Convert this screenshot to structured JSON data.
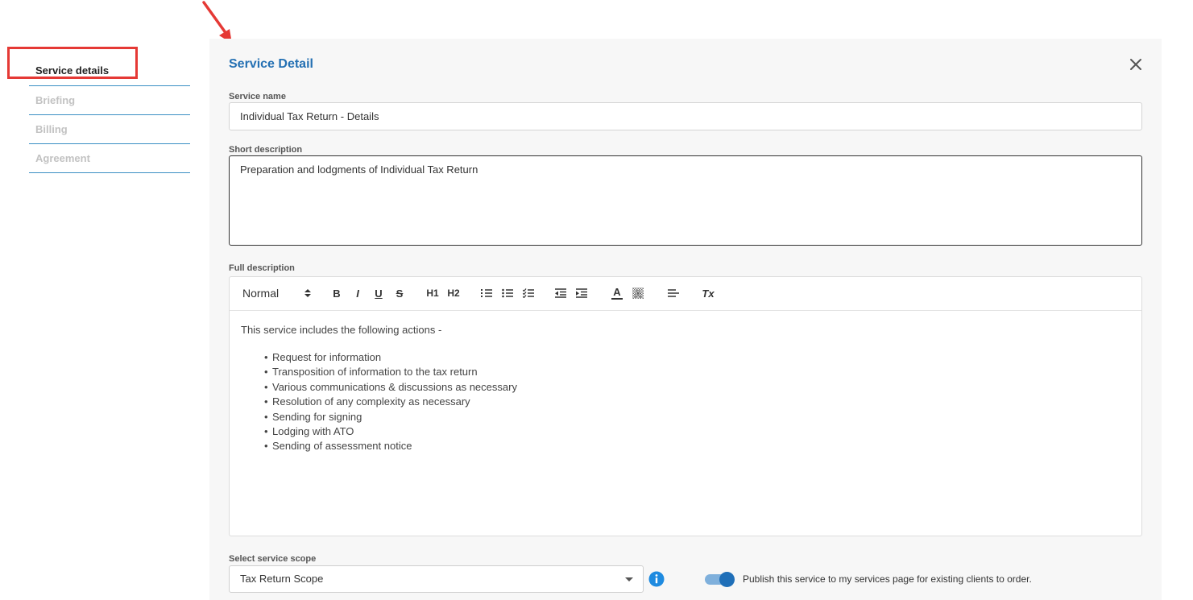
{
  "sidebar": {
    "items": [
      {
        "label": "Service details",
        "active": true
      },
      {
        "label": "Briefing",
        "active": false
      },
      {
        "label": "Billing",
        "active": false
      },
      {
        "label": "Agreement",
        "active": false
      }
    ]
  },
  "panel": {
    "title": "Service Detail",
    "close_icon": "close-icon"
  },
  "service_name": {
    "label": "Service name",
    "value": "Individual Tax Return - Details"
  },
  "short_description": {
    "label": "Short description",
    "value": "Preparation and lodgments of Individual Tax Return"
  },
  "full_description": {
    "label": "Full description",
    "toolbar": {
      "format_value": "Normal",
      "h1": "H1",
      "h2": "H2",
      "bold": "B",
      "italic": "I",
      "underline": "U",
      "strike": "S",
      "color": "A",
      "clear": "Tx"
    },
    "intro": "This service includes the following actions -",
    "bullets": [
      "Request for information",
      "Transposition of information to the tax return",
      "Various communications & discussions as necessary",
      "Resolution of any complexity as necessary",
      "Sending for signing",
      "Lodging with ATO",
      "Sending of assessment notice"
    ]
  },
  "scope": {
    "label": "Select service scope",
    "value": "Tax Return Scope"
  },
  "publish": {
    "enabled": true,
    "label": "Publish this service to my services page for existing clients to order."
  },
  "colors": {
    "accent": "#2470b3",
    "annotation": "#e53935",
    "divider": "#3a8fc4",
    "toggle": "#1f6fb8"
  }
}
